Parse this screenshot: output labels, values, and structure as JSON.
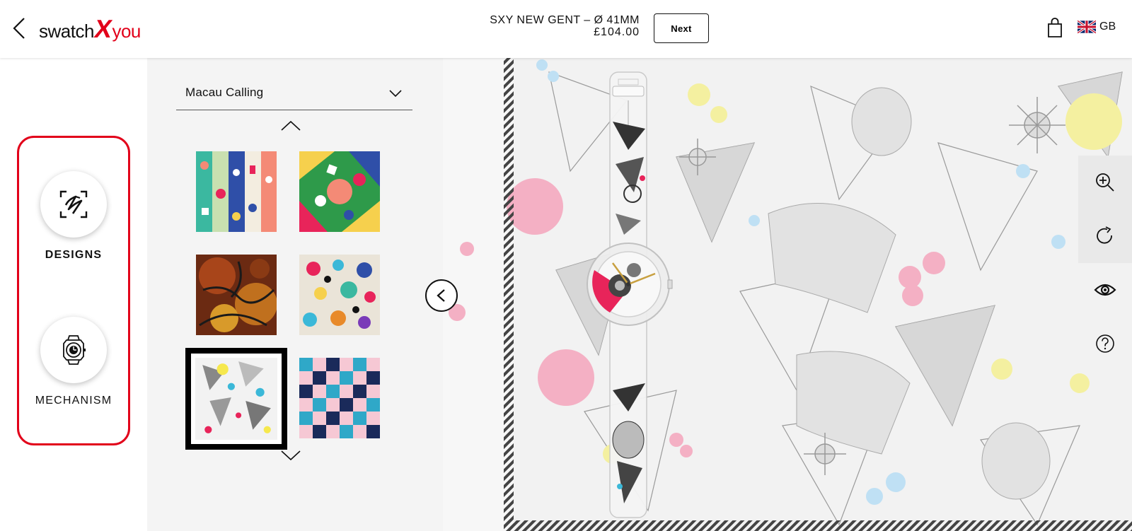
{
  "header": {
    "logo": {
      "part1": "swatch",
      "part2": "X",
      "part3": "you"
    },
    "product_name": "SXY NEW GENT",
    "product_size": " – Ø 41MM",
    "price": "£104.00",
    "next_label": "Next",
    "language": "GB"
  },
  "rail": {
    "items": [
      {
        "label": "DESIGNS",
        "icon": "designs-icon",
        "active": true
      },
      {
        "label": "MECHANISM",
        "icon": "watch-mechanism-icon",
        "active": false
      }
    ]
  },
  "panel": {
    "collection": "Macau Calling",
    "thumbnails": [
      {
        "id": "design-1",
        "selected": false
      },
      {
        "id": "design-2",
        "selected": false
      },
      {
        "id": "design-3",
        "selected": false
      },
      {
        "id": "design-4",
        "selected": false
      },
      {
        "id": "design-5",
        "selected": true
      },
      {
        "id": "design-6",
        "selected": false
      }
    ]
  },
  "tools": [
    "zoom-in-icon",
    "rotate-icon",
    "eye-icon",
    "help-icon"
  ],
  "colors": {
    "brand_red": "#e2001a",
    "panel_bg": "#f4f4f4",
    "accent_pink": "#e8245a"
  }
}
